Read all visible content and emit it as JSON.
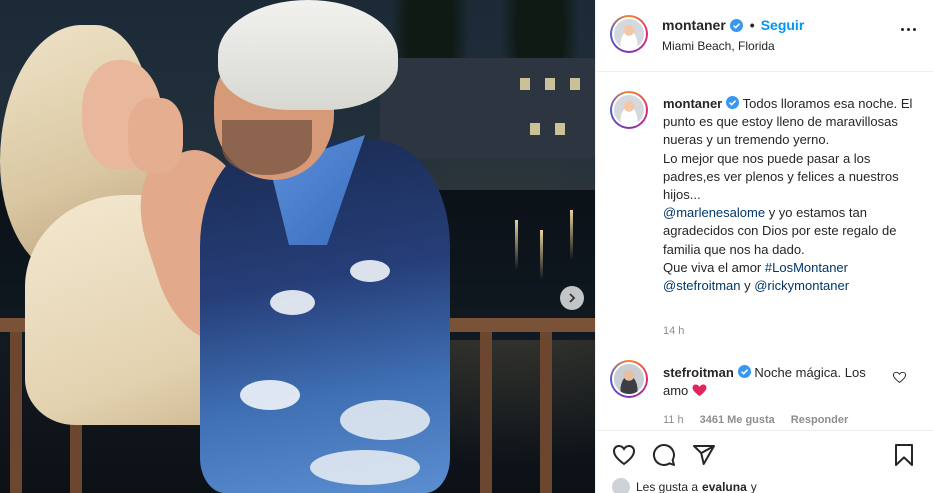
{
  "post": {
    "username": "montaner",
    "follow_label": "Seguir",
    "dot": "•",
    "location": "Miami Beach, Florida"
  },
  "caption": {
    "username": "montaner",
    "text_1": "Todos lloramos esa noche. El punto es que estoy lleno de maravillosas nueras y un tremendo yerno.\nLo mejor que nos puede pasar a los padres,es ver plenos y felices a nuestros hijos...\n",
    "mention_1": "@marlenesalome",
    "text_2": " y yo estamos tan agradecidos con Dios por este regalo de familia que nos ha dado.\nQue viva el amor ",
    "hashtag": "#LosMontaner",
    "mention_2": "@stefroitman",
    "text_3": " y ",
    "mention_3": "@rickymontaner",
    "time": "14 h"
  },
  "comment": {
    "username": "stefroitman",
    "text": "Noche mágica. Los amo",
    "time": "11 h",
    "likes": "3461 Me gusta",
    "reply": "Responder"
  },
  "likes_line": {
    "prefix": "Les gusta a",
    "user": "evaluna",
    "suffix": "y"
  },
  "colors": {
    "accent": "#0095f6",
    "verified": "#3897f0",
    "heart": "#ed4956",
    "link": "#00376b"
  },
  "icons": [
    "next-arrow-icon",
    "verified-icon",
    "more-icon",
    "heart-icon",
    "comment-icon",
    "share-icon",
    "bookmark-icon",
    "heart-emoji-icon"
  ]
}
